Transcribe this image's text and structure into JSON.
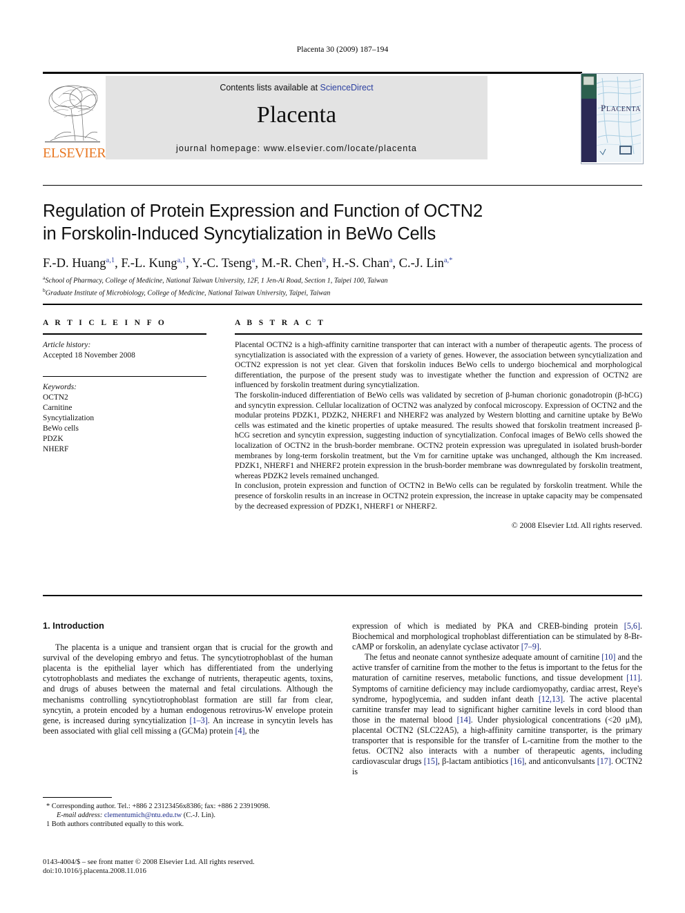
{
  "running_head": "Placenta 30 (2009) 187–194",
  "masthead": {
    "contents_prefix": "Contents lists available at ",
    "sciencedirect": "ScienceDirect",
    "journal_name": "Placenta",
    "homepage": "journal homepage: www.elsevier.com/locate/placenta",
    "publisher_logo_text": "ELSEVIER",
    "cover_title": "PLACENTA",
    "accent_color": "#E87722",
    "link_color": "#2b3fa0"
  },
  "title": {
    "line1": "Regulation of Protein Expression and Function of OCTN2",
    "line2": "in Forskolin-Induced Syncytialization in BeWo Cells"
  },
  "authors": [
    {
      "name": "F.-D. Huang",
      "marks": "a,1",
      "sep": ", "
    },
    {
      "name": "F.-L. Kung",
      "marks": "a,1",
      "sep": ", "
    },
    {
      "name": "Y.-C. Tseng",
      "marks": "a",
      "sep": ", "
    },
    {
      "name": "M.-R. Chen",
      "marks": "b",
      "sep": ", "
    },
    {
      "name": "H.-S. Chan",
      "marks": "a",
      "sep": ", "
    },
    {
      "name": "C.-J. Lin",
      "marks": "a,*",
      "sep": ""
    }
  ],
  "affiliations": [
    {
      "mark": "a",
      "text": "School of Pharmacy, College of Medicine, National Taiwan University, 12F, 1 Jen-Ai Road, Section 1, Taipei 100, Taiwan"
    },
    {
      "mark": "b",
      "text": "Graduate Institute of Microbiology, College of Medicine, National Taiwan University, Taipei, Taiwan"
    }
  ],
  "article_info": {
    "heading": "A R T I C L E   I N F O",
    "history_label": "Article history:",
    "history_value": "Accepted 18 November 2008",
    "keywords_label": "Keywords:",
    "keywords": [
      "OCTN2",
      "Carnitine",
      "Syncytialization",
      "BeWo cells",
      "PDZK",
      "NHERF"
    ]
  },
  "abstract": {
    "heading": "A B S T R A C T",
    "paragraphs": [
      "Placental OCTN2 is a high-affinity carnitine transporter that can interact with a number of therapeutic agents. The process of syncytialization is associated with the expression of a variety of genes. However, the association between syncytialization and OCTN2 expression is not yet clear. Given that forskolin induces BeWo cells to undergo biochemical and morphological differentiation, the purpose of the present study was to investigate whether the function and expression of OCTN2 are influenced by forskolin treatment during syncytialization.",
      "The forskolin-induced differentiation of BeWo cells was validated by secretion of β-human chorionic gonadotropin (β-hCG) and syncytin expression. Cellular localization of OCTN2 was analyzed by confocal microscopy. Expression of OCTN2 and the modular proteins PDZK1, PDZK2, NHERF1 and NHERF2 was analyzed by Western blotting and carnitine uptake by BeWo cells was estimated and the kinetic properties of uptake measured. The results showed that forskolin treatment increased β-hCG secretion and syncytin expression, suggesting induction of syncytialization. Confocal images of BeWo cells showed the localization of OCTN2 in the brush-border membrane. OCTN2 protein expression was upregulated in isolated brush-border membranes by long-term forskolin treatment, but the Vm for carnitine uptake was unchanged, although the Km increased. PDZK1, NHERF1 and NHERF2 protein expression in the brush-border membrane was downregulated by forskolin treatment, whereas PDZK2 levels remained unchanged.",
      "In conclusion, protein expression and function of OCTN2 in BeWo cells can be regulated by forskolin treatment. While the presence of forskolin results in an increase in OCTN2 protein expression, the increase in uptake capacity may be compensated by the decreased expression of PDZK1, NHERF1 or NHERF2."
    ],
    "copyright": "© 2008 Elsevier Ltd. All rights reserved."
  },
  "body": {
    "section_number_title": "1.  Introduction",
    "left_paragraph": "The placenta is a unique and transient organ that is crucial for the growth and survival of the developing embryo and fetus. The syncytiotrophoblast of the human placenta is the epithelial layer which has differentiated from the underlying cytotrophoblasts and mediates the exchange of nutrients, therapeutic agents, toxins, and drugs of abuses between the maternal and fetal circulations. Although the mechanisms controlling syncytiotrophoblast formation are still far from clear, syncytin, a protein encoded by a human endogenous retrovirus-W envelope protein gene, is increased during syncytialization [1–3]. An increase in syncytin levels has been associated with glial cell missing a (GCMa) protein [4], the",
    "right_paragraph_1": "expression of which is mediated by PKA and CREB-binding protein [5,6]. Biochemical and morphological trophoblast differentiation can be stimulated by 8-Br-cAMP or forskolin, an adenylate cyclase activator [7–9].",
    "right_paragraph_2": "The fetus and neonate cannot synthesize adequate amount of carnitine [10] and the active transfer of carnitine from the mother to the fetus is important to the fetus for the maturation of carnitine reserves, metabolic functions, and tissue development [11]. Symptoms of carnitine deficiency may include cardiomyopathy, cardiac arrest, Reye's syndrome, hypoglycemia, and sudden infant death [12,13]. The active placental carnitine transfer may lead to significant higher carnitine levels in cord blood than those in the maternal blood [14]. Under physiological concentrations (<20 μM), placental OCTN2 (SLC22A5), a high-affinity carnitine transporter, is the primary transporter that is responsible for the transfer of L-carnitine from the mother to the fetus. OCTN2 also interacts with a number of therapeutic agents, including cardiovascular drugs [15], β-lactam antibiotics [16], and anticonvulsants [17]. OCTN2 is"
  },
  "footnotes": {
    "corresponding": "* Corresponding author. Tel.: +886 2 23123456x8386; fax: +886 2 23919098.",
    "email_label": "E-mail address:",
    "email": "clementumich@ntu.edu.tw",
    "email_suffix": "(C.-J. Lin).",
    "equal_contrib": "1  Both authors contributed equally to this work."
  },
  "colophon": {
    "line1": "0143-4004/$ – see front matter © 2008 Elsevier Ltd. All rights reserved.",
    "line2": "doi:10.1016/j.placenta.2008.11.016"
  }
}
